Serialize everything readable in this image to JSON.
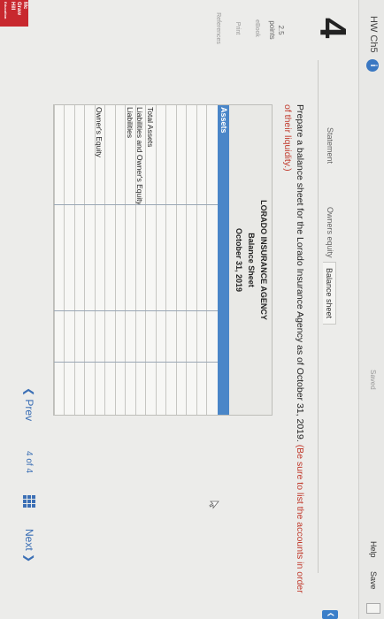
{
  "header": {
    "title": "HW Ch5",
    "saved_label": "Saved",
    "help_label": "Help",
    "save_label": "Save"
  },
  "logo": {
    "line1": "Mc",
    "line2": "Graw",
    "line3": "Hill",
    "line4": "Education"
  },
  "question": {
    "number": "4",
    "points_value": "2.5",
    "points_label": "points"
  },
  "side_links": [
    "eBook",
    "Print",
    "References"
  ],
  "tabs": [
    {
      "label": "Statement",
      "active": false
    },
    {
      "label": "Owners equity",
      "active": false
    },
    {
      "label": "Balance sheet",
      "active": true
    }
  ],
  "instructions": {
    "text": "Prepare a balance sheet for the Lorado Insurance Agency as of October 31, 2019.",
    "hint": "(Be sure to list the accounts in order of their liquidity.)"
  },
  "balance_sheet": {
    "company": "LORADO INSURANCE AGENCY",
    "title": "Balance Sheet",
    "date": "October 31, 2019",
    "assets_header": "Assets",
    "rows": [
      "",
      "",
      "",
      "",
      "",
      "",
      "Total Assets",
      "Liabilities and Owner's Equity",
      "Liabilities",
      "",
      "",
      "Owner's Equity",
      "",
      "",
      "",
      ""
    ]
  },
  "footer": {
    "prev_label": "Prev",
    "page_current": "4",
    "page_of": "of",
    "page_total": "4",
    "next_label": "Next"
  },
  "colors": {
    "accent": "#3b6fb5",
    "band": "#4a86c8",
    "hint": "#c0392b",
    "logo": "#c8282e"
  }
}
